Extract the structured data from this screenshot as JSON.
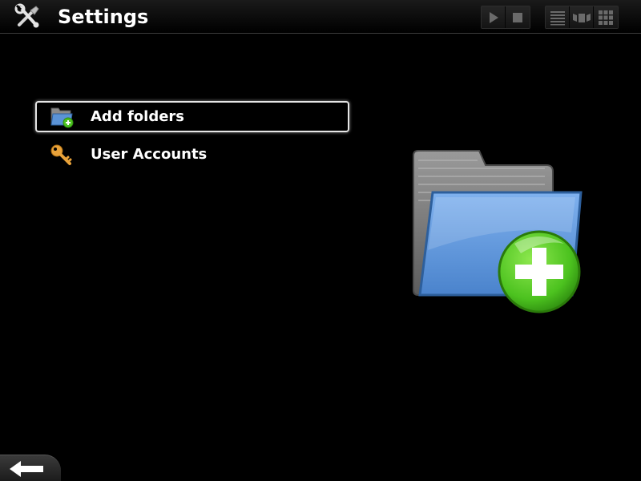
{
  "header": {
    "title": "Settings",
    "icon": "settings-tools-icon"
  },
  "media_controls": {
    "play_icon": "play-icon",
    "stop_icon": "stop-icon"
  },
  "view_controls": {
    "list_icon": "list-view-icon",
    "coverflow_icon": "coverflow-view-icon",
    "grid_icon": "grid-view-icon"
  },
  "menu": {
    "selected_index": 0,
    "items": [
      {
        "label": "Add folders",
        "icon": "add-folder-icon"
      },
      {
        "label": "User Accounts",
        "icon": "key-icon"
      }
    ]
  },
  "preview": {
    "icon": "add-folder-large-icon"
  },
  "footer": {
    "back_icon": "back-arrow-icon"
  },
  "colors": {
    "background": "#000000",
    "folder_blue": "#5b93d6",
    "plus_green": "#4cc21f",
    "key_orange": "#e8a23a"
  }
}
